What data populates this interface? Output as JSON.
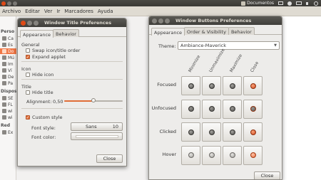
{
  "menubar": {
    "items": [
      "Archivo",
      "Editar",
      "Ver",
      "Ir",
      "Marcadores",
      "Ayuda"
    ]
  },
  "indicators": {
    "documents_label": "Documentos"
  },
  "sidebar": {
    "heading_personal": "Perso",
    "heading_devices": "Dispos",
    "heading_network": "Red",
    "items_personal": [
      "Ca",
      "Es",
      "Do",
      "Mú",
      "Im",
      "Ví",
      "De",
      "Pa"
    ],
    "items_devices": [
      "SE",
      "FL",
      "wi",
      "wi"
    ],
    "items_network": [
      "Ex"
    ]
  },
  "title_window": {
    "title": "Window Title Preferences",
    "tabs": [
      "Appearance",
      "Behavior"
    ],
    "general_label": "General",
    "swap_label": "Swap icon/title order",
    "expand_label": "Expand applet",
    "icon_label": "Icon",
    "hide_icon_label": "Hide icon",
    "title_label": "Title",
    "hide_title_label": "Hide title",
    "alignment_label": "Alignment:",
    "alignment_value": "0,50",
    "alignment_fraction": 0.5,
    "custom_style_label": "Custom style",
    "font_style_label": "Font style:",
    "font_name": "Sans",
    "font_size": "10",
    "font_color_label": "Font color:",
    "close_label": "Close",
    "checks": {
      "swap": false,
      "expand": true,
      "hide_icon": false,
      "hide_title": false,
      "custom_style": true
    }
  },
  "buttons_window": {
    "title": "Window Buttons Preferences",
    "tabs": [
      "Appearance",
      "Order & Visibility",
      "Behavior"
    ],
    "theme_label": "Theme:",
    "theme_value": "Ambiance-Maverick",
    "columns": [
      "Minimize",
      "Unmaximize",
      "Maximize",
      "Close"
    ],
    "rows": [
      "Focused",
      "Unfocused",
      "Clicked",
      "Hover"
    ],
    "close_label": "Close"
  },
  "colors": {
    "accent": "#e06d36",
    "panel": "#3c3b37",
    "close_button": "#df4a16"
  }
}
